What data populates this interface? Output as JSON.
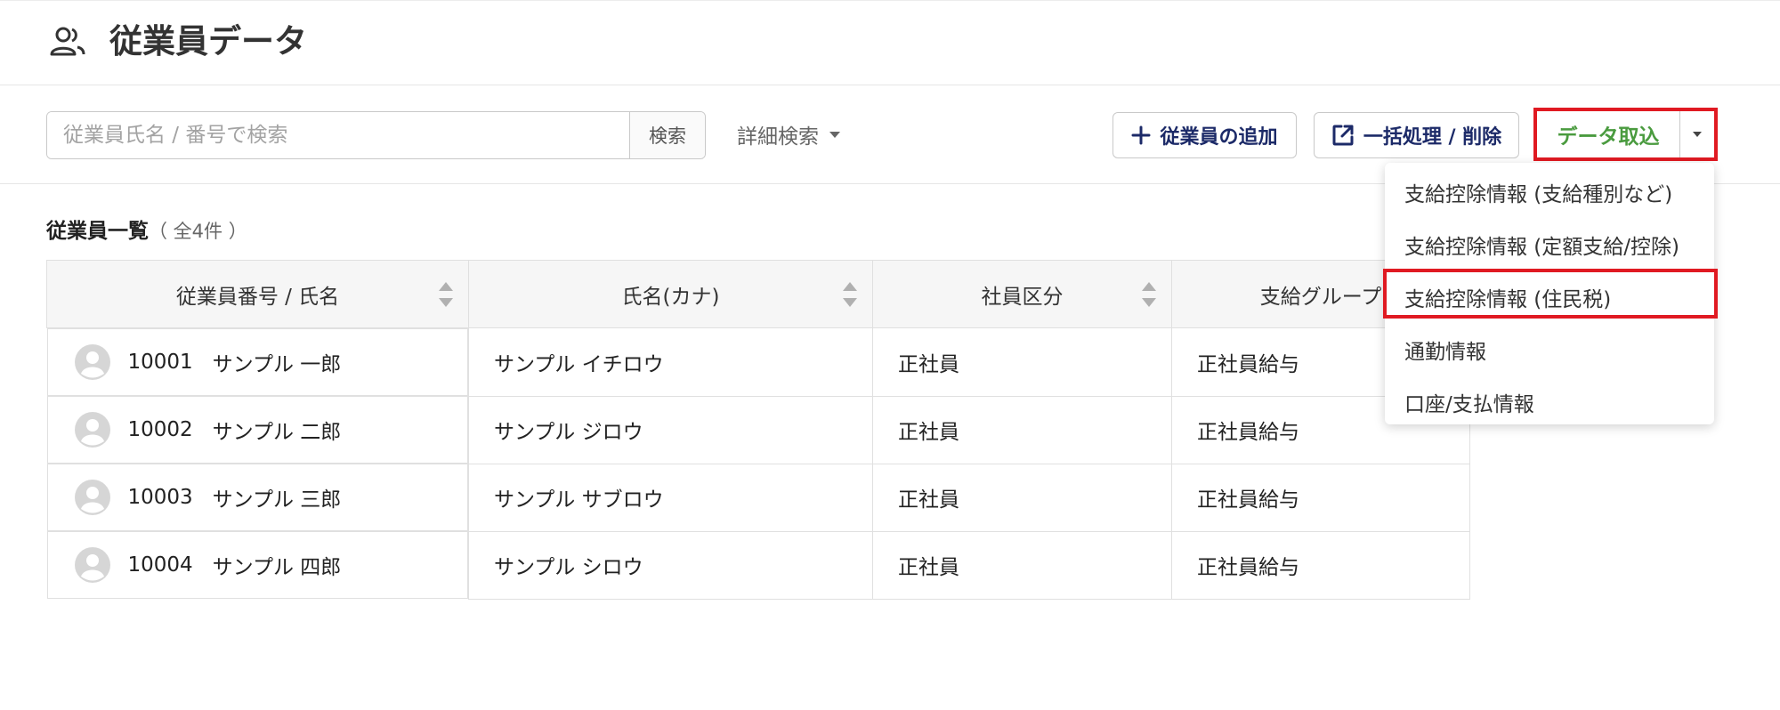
{
  "header": {
    "icon": "people-icon",
    "title": "従業員データ"
  },
  "toolbar": {
    "search_placeholder": "従業員氏名 / 番号で検索",
    "search_value": "",
    "search_button": "検索",
    "advanced_search": "詳細検索",
    "add_employee": "従業員の追加",
    "bulk_process": "一括処理 / 削除",
    "data_import": "データ取込"
  },
  "import_menu": {
    "items": [
      "支給控除情報 (支給種別など)",
      "支給控除情報 (定額支給/控除)",
      "支給控除情報 (住民税)",
      "通勤情報",
      "口座/支払情報"
    ],
    "highlighted_index": 2
  },
  "list": {
    "title": "従業員一覧",
    "count": "（ 全4件 ）",
    "columns": [
      "従業員番号 / 氏名",
      "氏名(カナ)",
      "社員区分",
      "支給グループ"
    ],
    "rows": [
      {
        "number": "10001",
        "name": "サンプル 一郎",
        "kana": "サンプル イチロウ",
        "type": "正社員",
        "group": "正社員給与"
      },
      {
        "number": "10002",
        "name": "サンプル 二郎",
        "kana": "サンプル ジロウ",
        "type": "正社員",
        "group": "正社員給与"
      },
      {
        "number": "10003",
        "name": "サンプル 三郎",
        "kana": "サンプル サブロウ",
        "type": "正社員",
        "group": "正社員給与"
      },
      {
        "number": "10004",
        "name": "サンプル 四郎",
        "kana": "サンプル シロウ",
        "type": "正社員",
        "group": "正社員給与"
      }
    ]
  },
  "colors": {
    "highlight": "#e01a22",
    "import_text": "#4a9b3f",
    "button_text": "#1c2a68"
  }
}
